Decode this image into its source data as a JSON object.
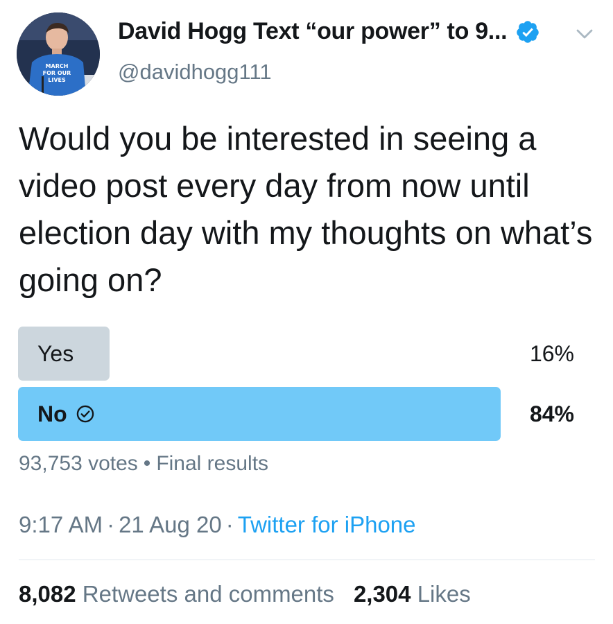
{
  "author": {
    "display_name": "David Hogg Text “our power” to 9...",
    "handle": "@davidhogg111",
    "verified": true,
    "avatar_shirt_text": [
      "MARCH",
      "FOR OUR",
      "LIVES"
    ]
  },
  "tweet": {
    "text": "Would you be interested in seeing a video post every day from now until election day with my thoughts on what’s going on?"
  },
  "poll": {
    "options": [
      {
        "label": "Yes",
        "percent_text": "16%",
        "percent": 16,
        "winner": false
      },
      {
        "label": "No",
        "percent_text": "84%",
        "percent": 84,
        "winner": true
      }
    ],
    "votes": "93,753 votes",
    "separator": "•",
    "status": "Final results"
  },
  "meta": {
    "time": "9:17 AM",
    "separator": "·",
    "date": "21 Aug 20",
    "source": "Twitter for iPhone"
  },
  "stats": {
    "retweets_count": "8,082",
    "retweets_label": "Retweets and comments",
    "likes_count": "2,304",
    "likes_label": "Likes"
  },
  "colors": {
    "verified": "#1da1f2",
    "poll_winner": "#71c9f8",
    "poll_other": "#ccd6dd",
    "link": "#1da1f2",
    "secondary_text": "#657786"
  }
}
